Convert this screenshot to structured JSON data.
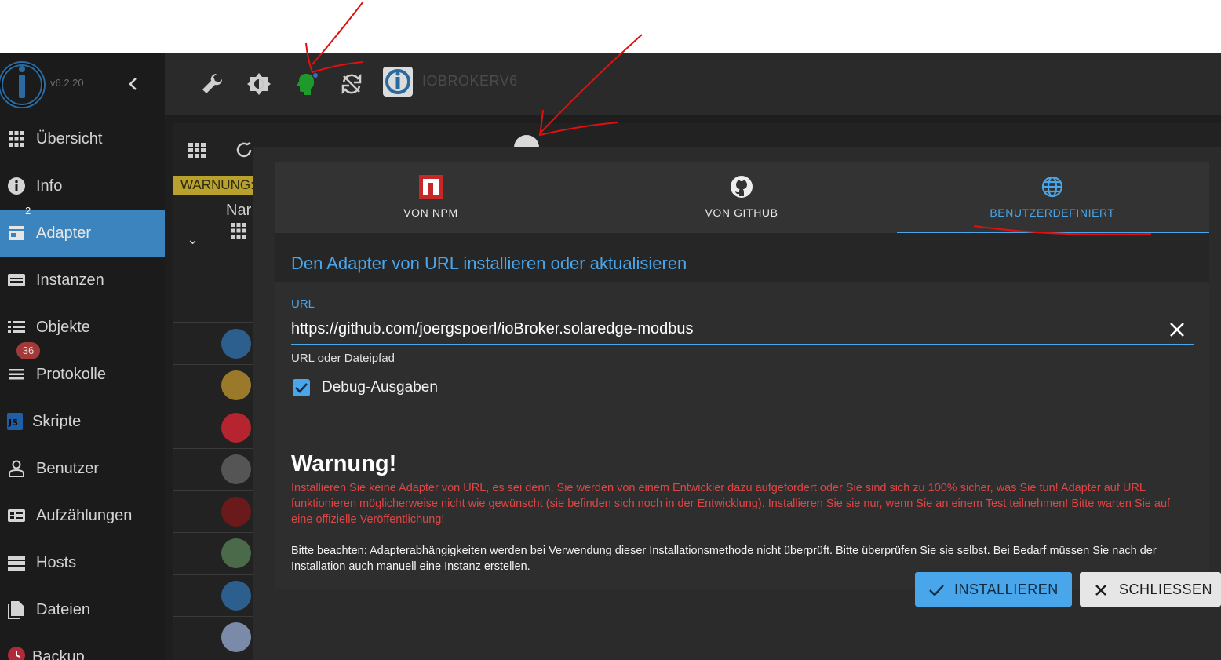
{
  "sidebar": {
    "version": "v6.2.20",
    "items": [
      {
        "label": "Übersicht",
        "icon": "grid-icon"
      },
      {
        "label": "Info",
        "icon": "info-icon"
      },
      {
        "label": "Adapter",
        "icon": "store-icon",
        "badge": "2",
        "active": true
      },
      {
        "label": "Instanzen",
        "icon": "instances-icon"
      },
      {
        "label": "Objekte",
        "icon": "list-icon"
      },
      {
        "label": "Protokolle",
        "icon": "log-icon",
        "badge": "36"
      },
      {
        "label": "Skripte",
        "icon": "js-icon"
      },
      {
        "label": "Benutzer",
        "icon": "user-icon"
      },
      {
        "label": "Aufzählungen",
        "icon": "enum-icon"
      },
      {
        "label": "Hosts",
        "icon": "hosts-icon"
      },
      {
        "label": "Dateien",
        "icon": "files-icon"
      },
      {
        "label": "Backup",
        "icon": "backup-icon"
      }
    ]
  },
  "topbar": {
    "host_name": "IOBROKERV6",
    "icons": [
      "wrench-icon",
      "theme-icon",
      "expert-mode-icon",
      "sync-icon"
    ]
  },
  "background": {
    "warning_label": "WARNUNG:",
    "name_column": "Nar"
  },
  "dialog": {
    "tabs": [
      {
        "label": "VON NPM",
        "icon": "npm-icon"
      },
      {
        "label": "VON GITHUB",
        "icon": "github-icon"
      },
      {
        "label": "BENUTZERDEFINIERT",
        "icon": "globe-icon",
        "selected": true
      }
    ],
    "title": "Den Adapter von URL installieren oder aktualisieren",
    "url_label": "URL",
    "url_value": "https://github.com/joergspoerl/ioBroker.solaredge-modbus",
    "url_helper": "URL oder Dateipfad",
    "debug_label": "Debug-Ausgaben",
    "debug_checked": true,
    "warning_title": "Warnung!",
    "warning_text": "Installieren Sie keine Adapter von URL, es sei denn, Sie werden von einem Entwickler dazu aufgefordert oder Sie sind sich zu 100% sicher, was Sie tun! Adapter auf URL funktionieren möglicherweise nicht wie gewünscht (sie befinden sich noch in der Entwicklung). Installieren Sie sie nur, wenn Sie an einem Test teilnehmen! Bitte warten Sie auf eine offizielle Veröffentlichung!",
    "note_text": "Bitte beachten: Adapterabhängigkeiten werden bei Verwendung dieser Installationsmethode nicht überprüft. Bitte überprüfen Sie sie selbst. Bei Bedarf müssen Sie nach der Installation auch manuell eine Instanz erstellen.",
    "install_label": "INSTALLIEREN",
    "close_label": "SCHLIESSEN"
  },
  "colors": {
    "accent": "#4aa6ea",
    "warning": "#e04545",
    "sidebar_active": "#3c84bd",
    "annotation": "#e01010"
  }
}
